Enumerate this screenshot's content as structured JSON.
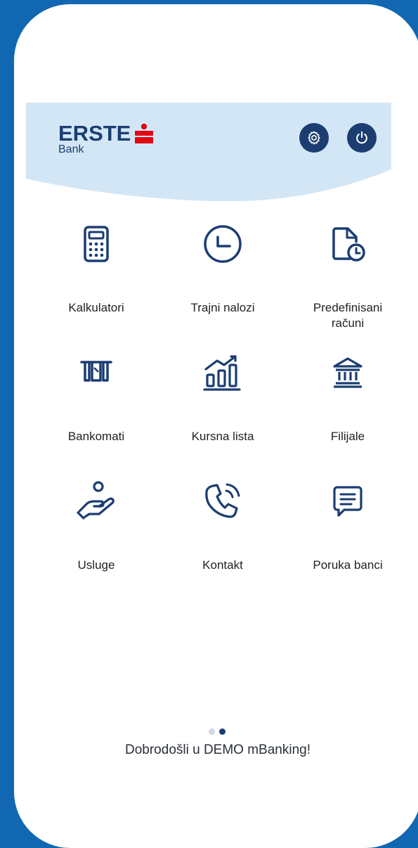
{
  "colors": {
    "frame": "#1167b1",
    "header_bg": "#d3e6f5",
    "brand_navy": "#1b3d72",
    "brand_red": "#e30613",
    "dot_inactive": "#d0d8e2",
    "dot_active": "#1b3d72"
  },
  "header": {
    "logo_text": "ERSTE",
    "logo_sub": "Bank",
    "settings_icon": "gear-icon",
    "logout_icon": "power-icon"
  },
  "menu": [
    {
      "label": "Kalkulatori",
      "icon": "calculator-icon"
    },
    {
      "label": "Trajni nalozi",
      "icon": "clock-icon"
    },
    {
      "label": "Predefinisani računi",
      "icon": "document-clock-icon"
    },
    {
      "label": "Bankomati",
      "icon": "atm-icon"
    },
    {
      "label": "Kursna lista",
      "icon": "bar-chart-icon"
    },
    {
      "label": "Filijale",
      "icon": "bank-building-icon"
    },
    {
      "label": "Usluge",
      "icon": "hand-service-icon"
    },
    {
      "label": "Kontakt",
      "icon": "phone-icon"
    },
    {
      "label": "Poruka banci",
      "icon": "message-icon"
    }
  ],
  "pagination": {
    "total": 2,
    "active": 2
  },
  "footer": {
    "welcome": "Dobrodošli u DEMO mBanking!"
  }
}
